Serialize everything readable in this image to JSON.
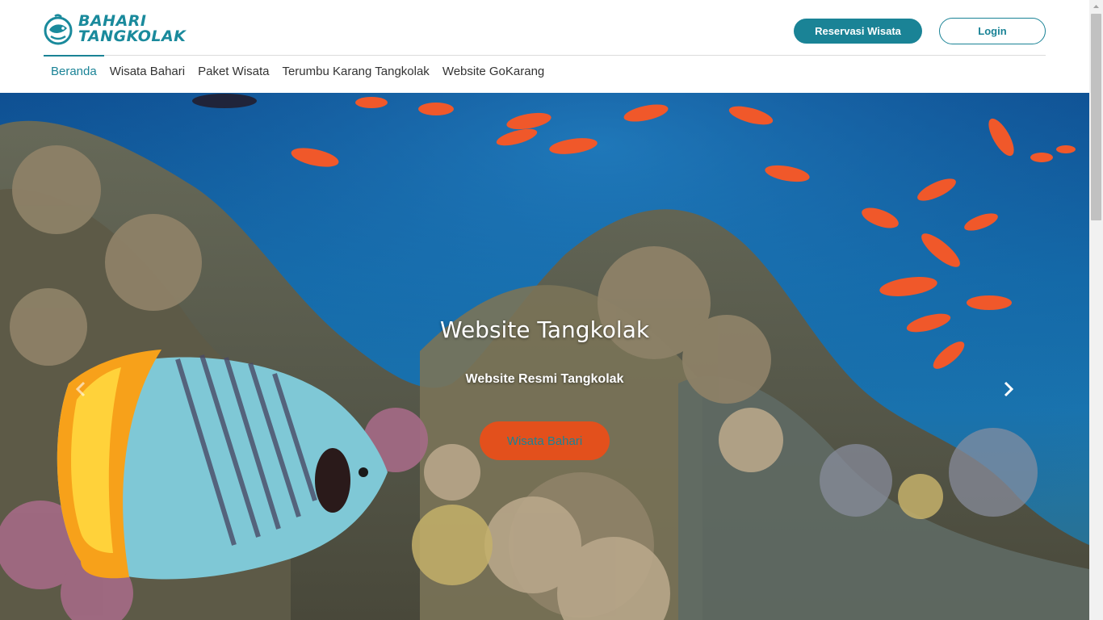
{
  "header": {
    "logo": {
      "line1": "BAHARI",
      "line2": "TANGKOLAK"
    },
    "reserve_button": "Reservasi Wisata",
    "login_button": "Login"
  },
  "nav": {
    "items": [
      {
        "label": "Beranda",
        "active": true
      },
      {
        "label": "Wisata Bahari",
        "active": false
      },
      {
        "label": "Paket Wisata",
        "active": false
      },
      {
        "label": "Terumbu Karang Tangkolak",
        "active": false
      },
      {
        "label": "Website GoKarang",
        "active": false
      }
    ]
  },
  "hero": {
    "title": "Website Tangkolak",
    "subtitle": "Website Resmi Tangkolak",
    "cta_label": "Wisata Bahari",
    "prev_icon": "chevron-left-icon",
    "next_icon": "chevron-right-icon"
  },
  "colors": {
    "brand": "#1a8396",
    "cta": "#e3501c",
    "text": "#333333"
  }
}
